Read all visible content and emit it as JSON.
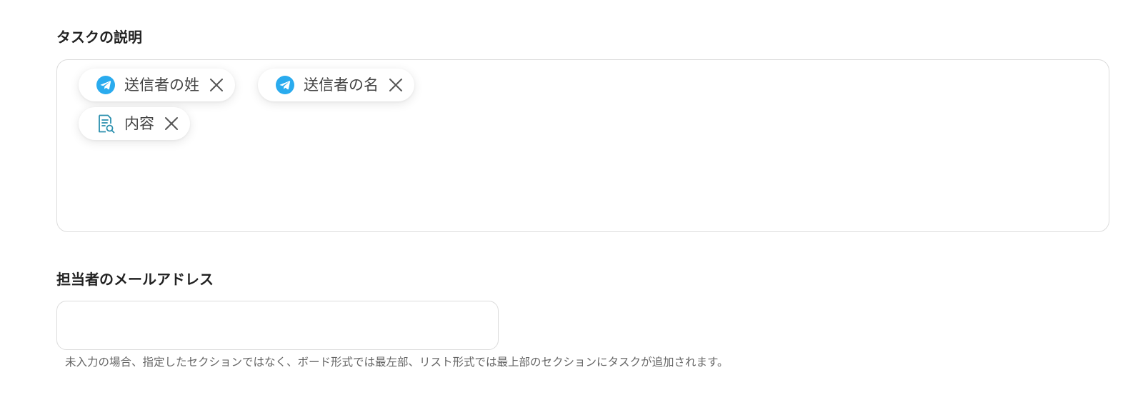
{
  "task_description": {
    "label": "タスクの説明",
    "tokens": [
      {
        "label": "送信者の姓",
        "icon": "telegram-icon",
        "icon_color": "#2AABEE"
      },
      {
        "label": "送信者の名",
        "icon": "telegram-icon",
        "icon_color": "#2AABEE"
      },
      {
        "label": "内容",
        "icon": "document-search-icon",
        "icon_color": "#2A8FAE"
      }
    ]
  },
  "assignee_email": {
    "label": "担当者のメールアドレス",
    "value": "",
    "placeholder": "",
    "help_text": "未入力の場合、指定したセクションではなく、ボード形式では最左部、リスト形式では最上部のセクションにタスクが追加されます。"
  },
  "colors": {
    "telegram": "#2AABEE",
    "document_icon": "#2A8FAE",
    "border": "#DCDCDC"
  }
}
